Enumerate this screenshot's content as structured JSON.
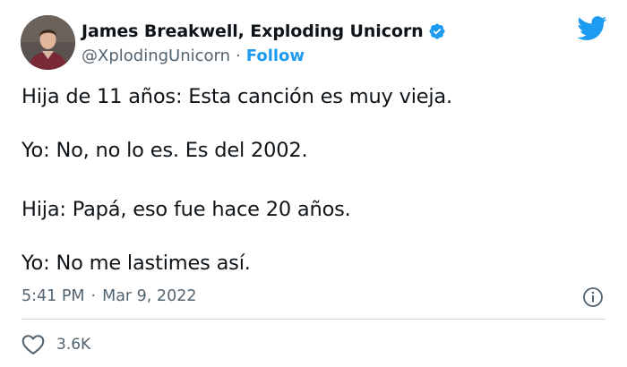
{
  "author": {
    "display_name": "James Breakwell, Exploding Unicorn",
    "handle": "@XplodingUnicorn",
    "separator": "·",
    "follow_label": "Follow"
  },
  "tweet": {
    "lines": [
      "Hija de 11 años: Esta canción es muy vieja.",
      "Yo: No, no lo es. Es del 2002.",
      "Hija: Papá, eso fue hace 20 años.",
      "Yo: No me lastimes así."
    ],
    "time": "5:41 PM",
    "dot": "·",
    "date": "Mar 9, 2022"
  },
  "engagement": {
    "likes": "3.6K"
  },
  "colors": {
    "accent": "#1d9bf0",
    "text": "#0f1419",
    "muted": "#536471",
    "divider": "#cfd9de"
  },
  "icons": {
    "verified": "verified-badge-icon",
    "brand": "twitter-bird-icon",
    "info": "info-icon",
    "like": "heart-icon"
  }
}
